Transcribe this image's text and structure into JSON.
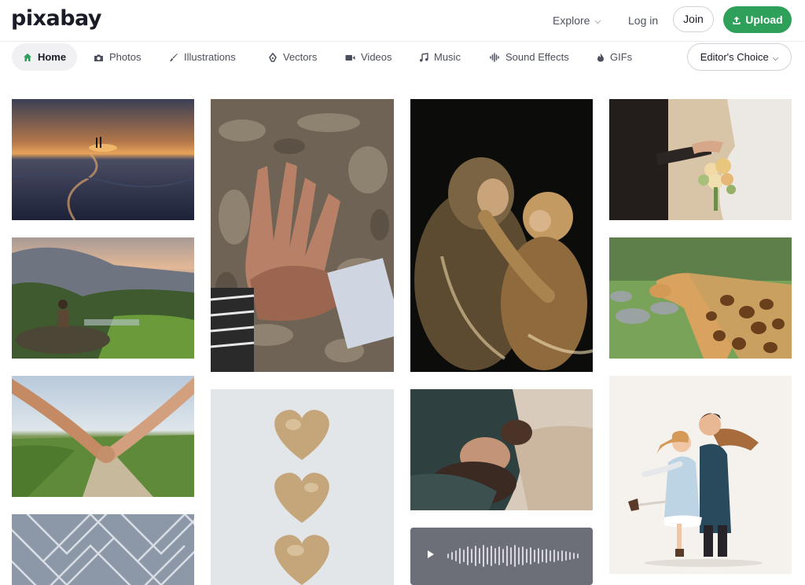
{
  "header": {
    "logo": "pixabay",
    "explore_label": "Explore",
    "login_label": "Log in",
    "join_label": "Join",
    "upload_label": "Upload"
  },
  "nav": {
    "items": [
      {
        "label": "Home",
        "icon": "home-icon",
        "active": true
      },
      {
        "label": "Photos",
        "icon": "camera-icon"
      },
      {
        "label": "Illustrations",
        "icon": "brush-icon"
      },
      {
        "label": "Vectors",
        "icon": "pen-nib-icon"
      },
      {
        "label": "Videos",
        "icon": "video-icon"
      },
      {
        "label": "Music",
        "icon": "music-note-icon"
      },
      {
        "label": "Sound Effects",
        "icon": "waveform-icon"
      },
      {
        "label": "GIFs",
        "icon": "flame-icon"
      }
    ],
    "sort_label": "Editor's Choice"
  },
  "colors": {
    "accent": "#2ea05a",
    "text": "#191b26",
    "muted": "#4c4f5c"
  },
  "gallery": {
    "items": [
      {
        "subject": "couple at sunset on beach"
      },
      {
        "subject": "man sitting on rock in valley"
      },
      {
        "subject": "holding hands on country road"
      },
      {
        "subject": "chain link fence"
      },
      {
        "subject": "old hands on tree bark"
      },
      {
        "subject": "three golden hearts"
      },
      {
        "subject": "monkey and baby"
      },
      {
        "subject": "woman lying on blanket"
      },
      {
        "subject": "audio waveform player"
      },
      {
        "subject": "bride and groom holding hands"
      },
      {
        "subject": "two giraffes"
      },
      {
        "subject": "illustrated couple hugging"
      }
    ]
  }
}
